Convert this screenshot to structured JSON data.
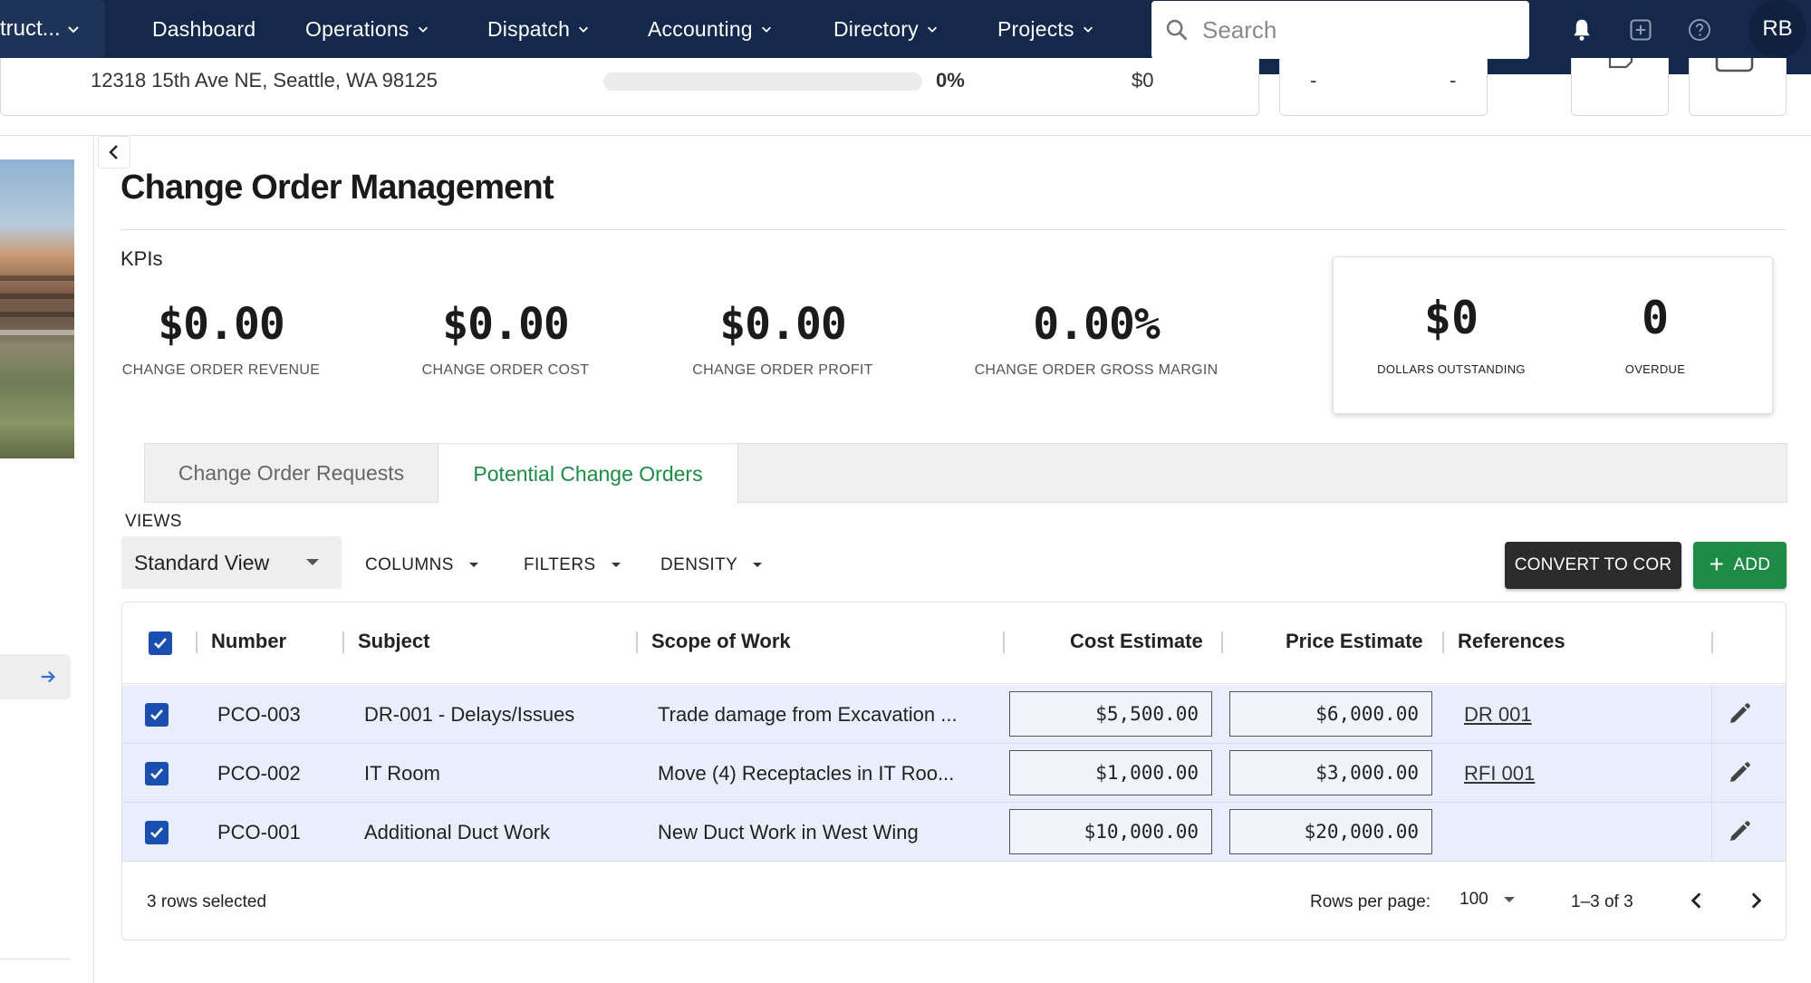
{
  "nav": {
    "company": "truct...",
    "items": [
      "Dashboard",
      "Operations",
      "Dispatch",
      "Accounting",
      "Directory",
      "Projects"
    ],
    "search_placeholder": "Search",
    "avatar": "RB"
  },
  "project_strip": {
    "address": "12318 15th Ave NE, Seattle, WA 98125",
    "progress_percent": "0%",
    "progress_value": 0,
    "amount": "$0",
    "dash_a": "-",
    "dash_b": "-"
  },
  "page": {
    "title": "Change Order Management",
    "kpis_label": "KPIs"
  },
  "kpis": [
    {
      "value": "$0.00",
      "label": "CHANGE ORDER REVENUE"
    },
    {
      "value": "$0.00",
      "label": "CHANGE ORDER COST"
    },
    {
      "value": "$0.00",
      "label": "CHANGE ORDER PROFIT"
    },
    {
      "value": "0.00%",
      "label": "CHANGE ORDER GROSS MARGIN"
    }
  ],
  "summary_card": [
    {
      "value": "$0",
      "label": "DOLLARS OUTSTANDING"
    },
    {
      "value": "0",
      "label": "OVERDUE"
    }
  ],
  "tabs": [
    {
      "label": "Change Order Requests",
      "active": false
    },
    {
      "label": "Potential Change Orders",
      "active": true
    }
  ],
  "toolbar": {
    "views_label": "VIEWS",
    "view_selected": "Standard View",
    "columns": "COLUMNS",
    "filters": "FILTERS",
    "density": "DENSITY",
    "convert": "CONVERT TO COR",
    "add": "ADD"
  },
  "table": {
    "columns": [
      "Number",
      "Subject",
      "Scope of Work",
      "Cost Estimate",
      "Price Estimate",
      "References"
    ],
    "rows": [
      {
        "number": "PCO-003",
        "subject": "DR-001 - Delays/Issues",
        "scope": "Trade damage from Excavation ...",
        "cost": "$5,500.00",
        "price": "$6,000.00",
        "ref": "DR 001",
        "checked": true
      },
      {
        "number": "PCO-002",
        "subject": "IT Room",
        "scope": "Move (4) Receptacles in IT Roo...",
        "cost": "$1,000.00",
        "price": "$3,000.00",
        "ref": "RFI 001",
        "checked": true
      },
      {
        "number": "PCO-001",
        "subject": "Additional Duct Work",
        "scope": "New Duct Work in West Wing",
        "cost": "$10,000.00",
        "price": "$20,000.00",
        "ref": "",
        "checked": true
      }
    ],
    "footer": {
      "selected": "3 rows selected",
      "rows_per_page_label": "Rows per page:",
      "rows_per_page": "100",
      "range": "1–3 of 3"
    }
  },
  "colors": {
    "nav_bg": "#14284b",
    "accent_green": "#1d8a45",
    "checkbox_blue": "#1a4fb0",
    "selected_row": "#e8eefb"
  }
}
